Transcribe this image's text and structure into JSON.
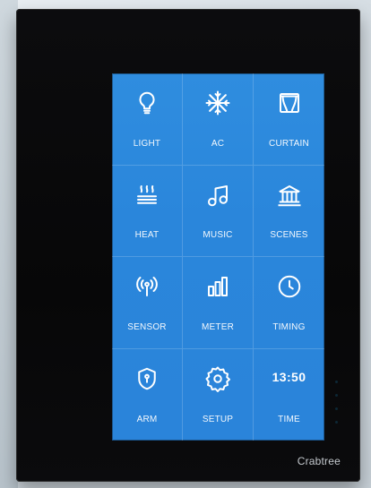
{
  "tiles": [
    {
      "label": "LIGHT",
      "icon": "bulb-icon"
    },
    {
      "label": "AC",
      "icon": "snowflake-icon"
    },
    {
      "label": "CURTAIN",
      "icon": "curtain-icon"
    },
    {
      "label": "HEAT",
      "icon": "heat-icon"
    },
    {
      "label": "MUSIC",
      "icon": "music-icon"
    },
    {
      "label": "SCENES",
      "icon": "building-icon"
    },
    {
      "label": "SENSOR",
      "icon": "sensor-icon"
    },
    {
      "label": "METER",
      "icon": "meter-icon"
    },
    {
      "label": "TIMING",
      "icon": "clock-icon"
    },
    {
      "label": "ARM",
      "icon": "shield-icon"
    },
    {
      "label": "SETUP",
      "icon": "gear-icon"
    },
    {
      "label": "TIME",
      "time": "13:50",
      "icon": "time-display"
    }
  ],
  "brand": "Crabtree",
  "colors": {
    "screen": "#2f8ddf",
    "panel": "#0c0c0e",
    "text": "#ffffff"
  }
}
